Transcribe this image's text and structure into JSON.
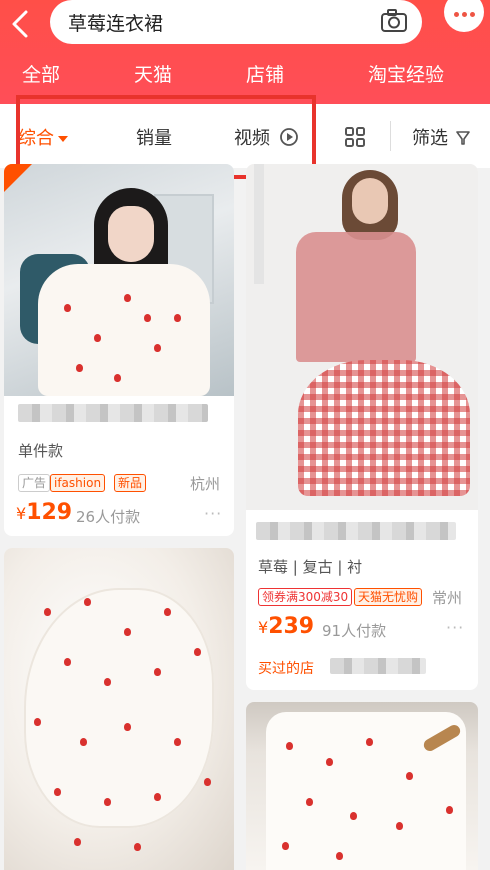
{
  "search": {
    "query": "草莓连衣裙"
  },
  "categories": [
    "全部",
    "天猫",
    "店铺",
    "淘宝经验"
  ],
  "sort": {
    "items": [
      {
        "label": "综合",
        "active": true
      },
      {
        "label": "销量",
        "active": false
      },
      {
        "label": "视频",
        "active": false
      }
    ],
    "filter_label": "筛选"
  },
  "products": [
    {
      "subtitle": "单件款",
      "tags": [
        "广告",
        "ifashion",
        "新品"
      ],
      "price_symbol": "¥",
      "price": "129",
      "sales": "26人付款",
      "city": "杭州"
    },
    {
      "subtitle": "草莓 | 复古 | 衬",
      "tags": [
        "领券满300减30",
        "天猫无忧购"
      ],
      "price_symbol": "¥",
      "price": "239",
      "sales": "91人付款",
      "city": "常州",
      "shop_note": "买过的店"
    }
  ],
  "colors": {
    "brand": "#ff5000",
    "header": "#ff4f4f",
    "highlight": "#e8332c"
  }
}
